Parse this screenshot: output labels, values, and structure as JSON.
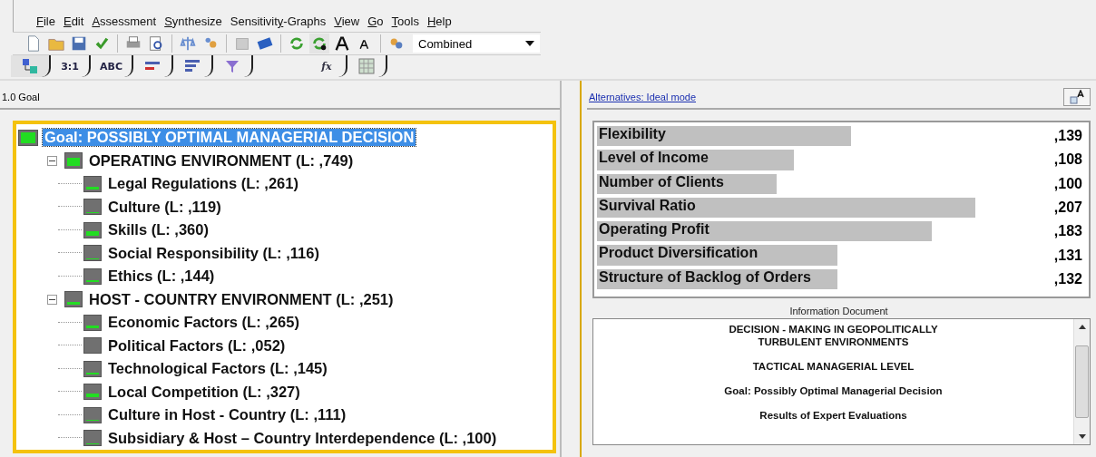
{
  "menu": [
    {
      "label": "File"
    },
    {
      "label": "Edit"
    },
    {
      "label": "Assessment"
    },
    {
      "label": "Synthesize"
    },
    {
      "label": "Sensitivity-Graphs"
    },
    {
      "label": "View"
    },
    {
      "label": "Go"
    },
    {
      "label": "Tools"
    },
    {
      "label": "Help"
    }
  ],
  "toolbar": {
    "mode_select": {
      "value": "Combined"
    }
  },
  "tabs": [
    {
      "kind": "icon",
      "selected": true
    },
    {
      "kind": "text",
      "label": "3:1",
      "selected": false
    },
    {
      "kind": "text",
      "label": "ABC",
      "selected": false
    },
    {
      "kind": "icon",
      "selected": false
    },
    {
      "kind": "icon",
      "selected": false
    },
    {
      "kind": "icon",
      "selected": false
    },
    {
      "kind": "text",
      "label": "fx",
      "selected": false
    },
    {
      "kind": "icon",
      "selected": false
    }
  ],
  "left_panel": {
    "header": "1.0 Goal",
    "tree": [
      {
        "label": "Goal: POSSIBLY OPTIMAL MANAGERIAL DECISION",
        "selected": true,
        "children": [
          {
            "label": "OPERATING ENVIRONMENT (L: ,749)",
            "selected": false,
            "expanded": true,
            "children": [
              {
                "label": "Legal Regulations (L: ,261)",
                "selected": false
              },
              {
                "label": "Culture (L: ,119)",
                "selected": false
              },
              {
                "label": "Skills (L: ,360)",
                "selected": false
              },
              {
                "label": "Social Responsibility (L: ,116)",
                "selected": false
              },
              {
                "label": "Ethics (L: ,144)",
                "selected": false
              }
            ]
          },
          {
            "label": "HOST - COUNTRY ENVIRONMENT (L: ,251)",
            "selected": false,
            "expanded": true,
            "children": [
              {
                "label": "Economic Factors (L: ,265)",
                "selected": false
              },
              {
                "label": "Political Factors (L: ,052)",
                "selected": false
              },
              {
                "label": "Technological Factors (L: ,145)",
                "selected": false
              },
              {
                "label": "Local Competition (L: ,327)",
                "selected": false
              },
              {
                "label": "Culture in Host - Country (L: ,111)",
                "selected": false
              },
              {
                "label": "Subsidiary & Host – Country Interdependence (L: ,100)",
                "selected": false
              }
            ]
          }
        ]
      }
    ]
  },
  "right_panel": {
    "header_link": "Alternatives: Ideal mode",
    "alternatives": [
      {
        "name": "Flexibility",
        "value": ",139"
      },
      {
        "name": "Level of Income",
        "value": ",108"
      },
      {
        "name": "Number of Clients",
        "value": ",100"
      },
      {
        "name": "Survival Ratio",
        "value": ",207"
      },
      {
        "name": "Operating Profit",
        "value": ",183"
      },
      {
        "name": "Product Diversification",
        "value": ",131"
      },
      {
        "name": "Structure of Backlog of Orders",
        "value": ",132"
      }
    ],
    "information_document": {
      "title": "Information Document",
      "lines": [
        "DECISION - MAKING IN GEOPOLITICALLY\nTURBULENT ENVIRONMENTS",
        "TACTICAL MANAGERIAL LEVEL",
        "Goal: Possibly Optimal Managerial Decision",
        "Results of Expert Evaluations"
      ]
    }
  }
}
